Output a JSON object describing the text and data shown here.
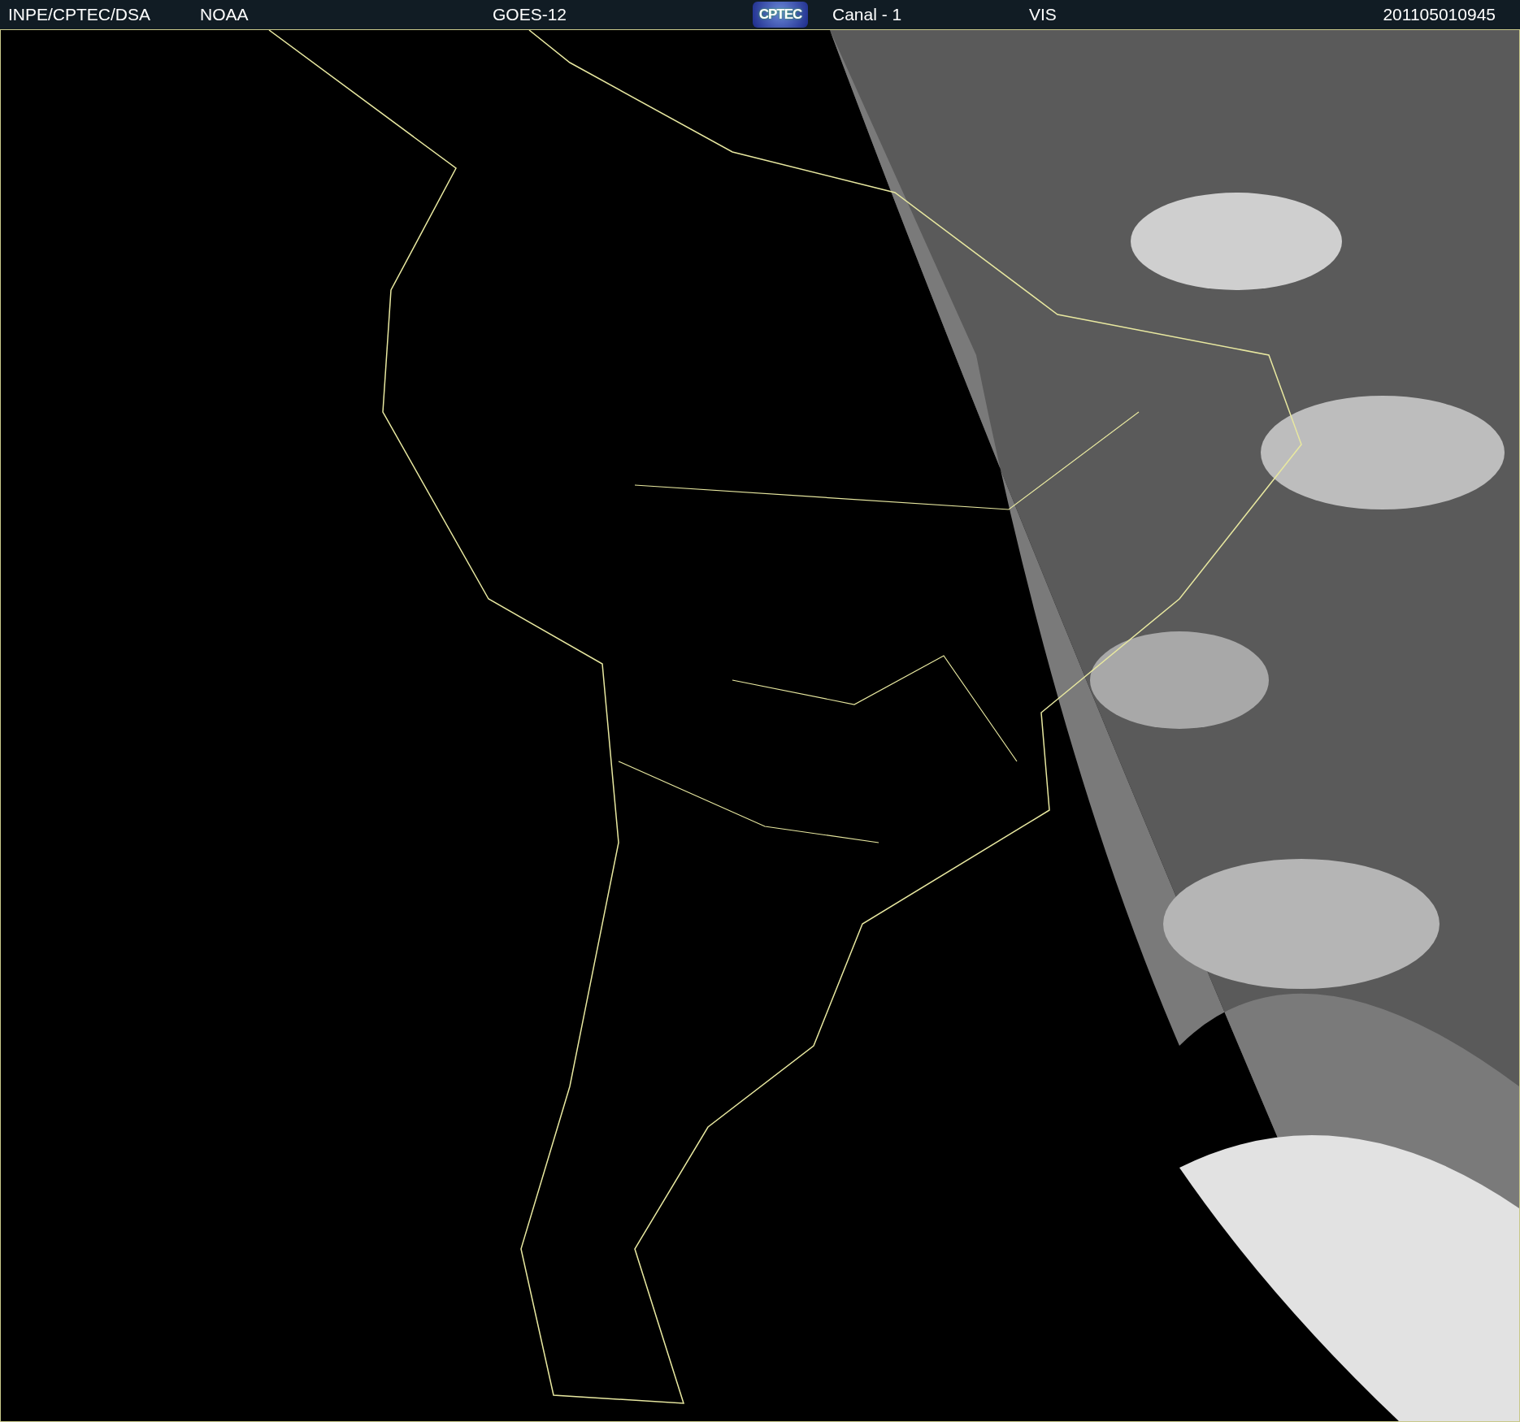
{
  "header": {
    "items": [
      {
        "kind": "text",
        "text": "INPE/CPTEC/DSA"
      },
      {
        "kind": "text",
        "text": "NOAA"
      },
      {
        "kind": "text",
        "text": "GOES-12"
      },
      {
        "kind": "logo",
        "text": "CPTEC"
      },
      {
        "kind": "text",
        "text": "Canal - 1"
      },
      {
        "kind": "text",
        "text": "VIS"
      },
      {
        "kind": "text",
        "text": "201105010945"
      }
    ]
  }
}
